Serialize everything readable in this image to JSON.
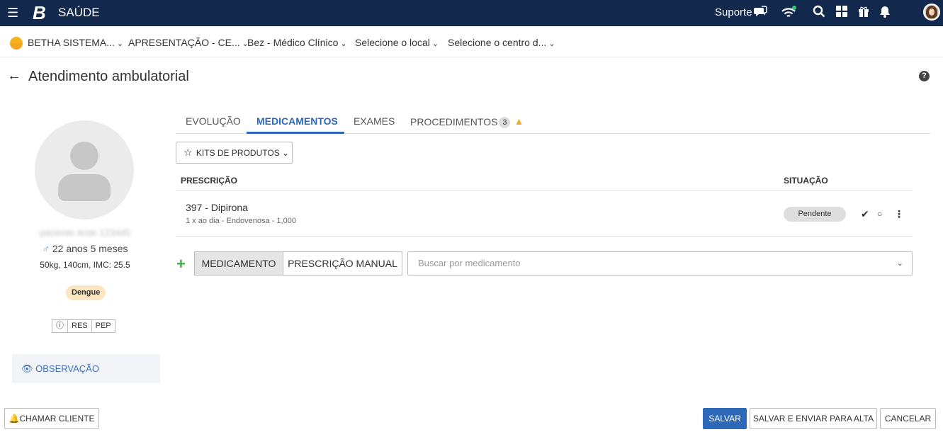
{
  "topbar": {
    "menu_icon": "hamburger-menu-icon",
    "logo": "B",
    "app_name": "SAÚDE",
    "suporte": "Suporte",
    "icons": [
      "chat-support-icon",
      "wifi-icon",
      "search-icon",
      "apps-grid-icon",
      "gift-icon",
      "bell-icon",
      "user-avatar"
    ]
  },
  "context": {
    "entity": "BETHA SISTEMA...",
    "database": "APRESENTAÇÃO - CE...",
    "professional": "Bez - Médico Clínico",
    "local": "Selecione o local",
    "centro": "Selecione o centro d..."
  },
  "page": {
    "title": "Atendimento ambulatorial"
  },
  "patient": {
    "name": "paciente teste 123445",
    "age": "22 anos 5 meses",
    "sex_symbol": "♂",
    "measures": "50kg, 140cm, IMC: 25.5",
    "tag": "Dengue",
    "buttons": [
      "ⓘ",
      "RES",
      "PEP"
    ],
    "observacao": "OBSERVAÇÃO"
  },
  "tabs": [
    {
      "label": "EVOLUÇÃO"
    },
    {
      "label": "MEDICAMENTOS",
      "active": true
    },
    {
      "label": "EXAMES"
    },
    {
      "label": "PROCEDIMENTOS",
      "badge": "3"
    }
  ],
  "kits_label": "KITS DE PRODUTOS",
  "table": {
    "col_prescricao": "PRESCRIÇÃO",
    "col_situacao": "SITUAÇÃO",
    "rows": [
      {
        "name": "397 - Dipirona",
        "desc": "1 x ao dia - Endovenosa - 1,000",
        "status": "Pendente"
      }
    ]
  },
  "add": {
    "medicamento": "MEDICAMENTO",
    "manual": "PRESCRIÇÃO MANUAL",
    "search_placeholder": "Buscar por medicamento"
  },
  "footer": {
    "chamar": "CHAMAR CLIENTE",
    "salvar": "SALVAR",
    "salvar_alta": "SALVAR E ENVIAR PARA ALTA",
    "cancelar": "CANCELAR"
  },
  "colors": {
    "topbar": "#12284c",
    "accent": "#2d69b8",
    "add": "#3fae4a",
    "warning": "#f0a92c"
  }
}
